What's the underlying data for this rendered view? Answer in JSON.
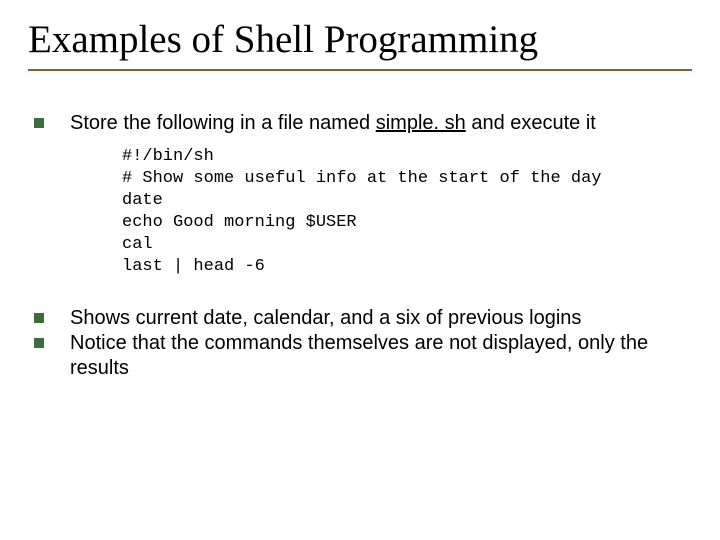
{
  "title": "Examples of Shell Programming",
  "bullets": [
    {
      "pre": "Store the following in a file named ",
      "underlined": "simple. sh",
      "post": " and execute it"
    },
    {
      "text": "Shows current date, calendar, and a six of previous logins"
    },
    {
      "text": "Notice that the commands themselves are not displayed, only the results"
    }
  ],
  "code": {
    "l0": "#!/bin/sh",
    "l1": "# Show some useful info at the start of the day",
    "l2": "date",
    "l3": "echo Good morning $USER",
    "l4": "cal",
    "l5": "last | head -6"
  }
}
